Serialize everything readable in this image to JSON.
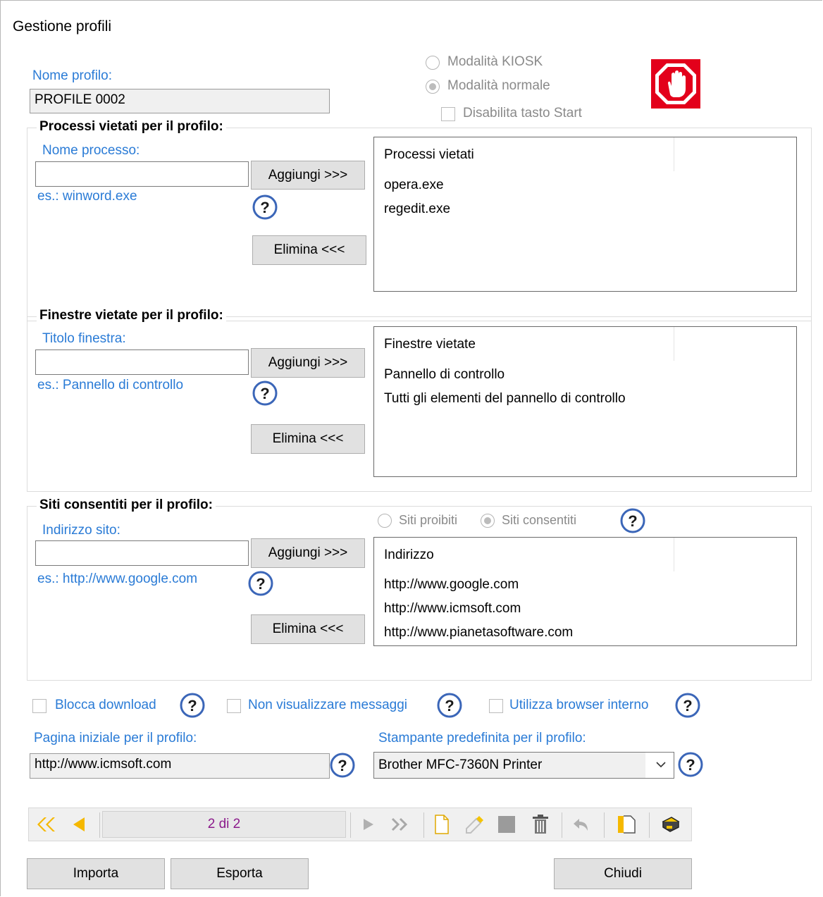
{
  "window": {
    "title": "Gestione profili"
  },
  "profile": {
    "name_label": "Nome profilo:",
    "name_value": "PROFILE 0002",
    "mode_kiosk": "Modalità KIOSK",
    "mode_normal": "Modalità normale",
    "disable_start": "Disabilita tasto Start"
  },
  "processes": {
    "group_title": "Processi vietati per il profilo:",
    "field_label": "Nome processo:",
    "example": "es.: winword.exe",
    "add_label": "Aggiungi >>>",
    "remove_label": "Elimina <<<",
    "list_header": "Processi vietati",
    "items": [
      "opera.exe",
      "regedit.exe"
    ]
  },
  "windows": {
    "group_title": "Finestre vietate per il profilo:",
    "field_label": "Titolo finestra:",
    "example": "es.: Pannello di controllo",
    "add_label": "Aggiungi >>>",
    "remove_label": "Elimina <<<",
    "list_header": "Finestre vietate",
    "items": [
      "Pannello di controllo",
      "Tutti gli elementi del pannello di controllo"
    ]
  },
  "sites": {
    "group_title": "Siti consentiti per il profilo:",
    "field_label": "Indirizzo sito:",
    "example": "es.: http://www.google.com",
    "add_label": "Aggiungi >>>",
    "remove_label": "Elimina <<<",
    "radio_forbidden": "Siti proibiti",
    "radio_allowed": "Siti consentiti",
    "list_header": "Indirizzo",
    "items": [
      "http://www.google.com",
      "http://www.icmsoft.com",
      "http://www.pianetasoftware.com"
    ]
  },
  "options": {
    "block_download": "Blocca download",
    "no_messages": "Non visualizzare messaggi",
    "internal_browser": "Utilizza browser interno"
  },
  "homepage": {
    "label": "Pagina iniziale per il profilo:",
    "value": "http://www.icmsoft.com"
  },
  "printer": {
    "label": "Stampante predefinita per il profilo:",
    "value": "Brother MFC-7360N Printer"
  },
  "navigator": {
    "position": "2 di 2"
  },
  "buttons": {
    "import": "Importa",
    "export": "Esporta",
    "close": "Chiudi"
  },
  "colors": {
    "accent_text": "#2a7bd6",
    "nav_arrows": "#f5b800",
    "stop_icon": "#e3001b",
    "counter_text": "#8b1a8b"
  }
}
